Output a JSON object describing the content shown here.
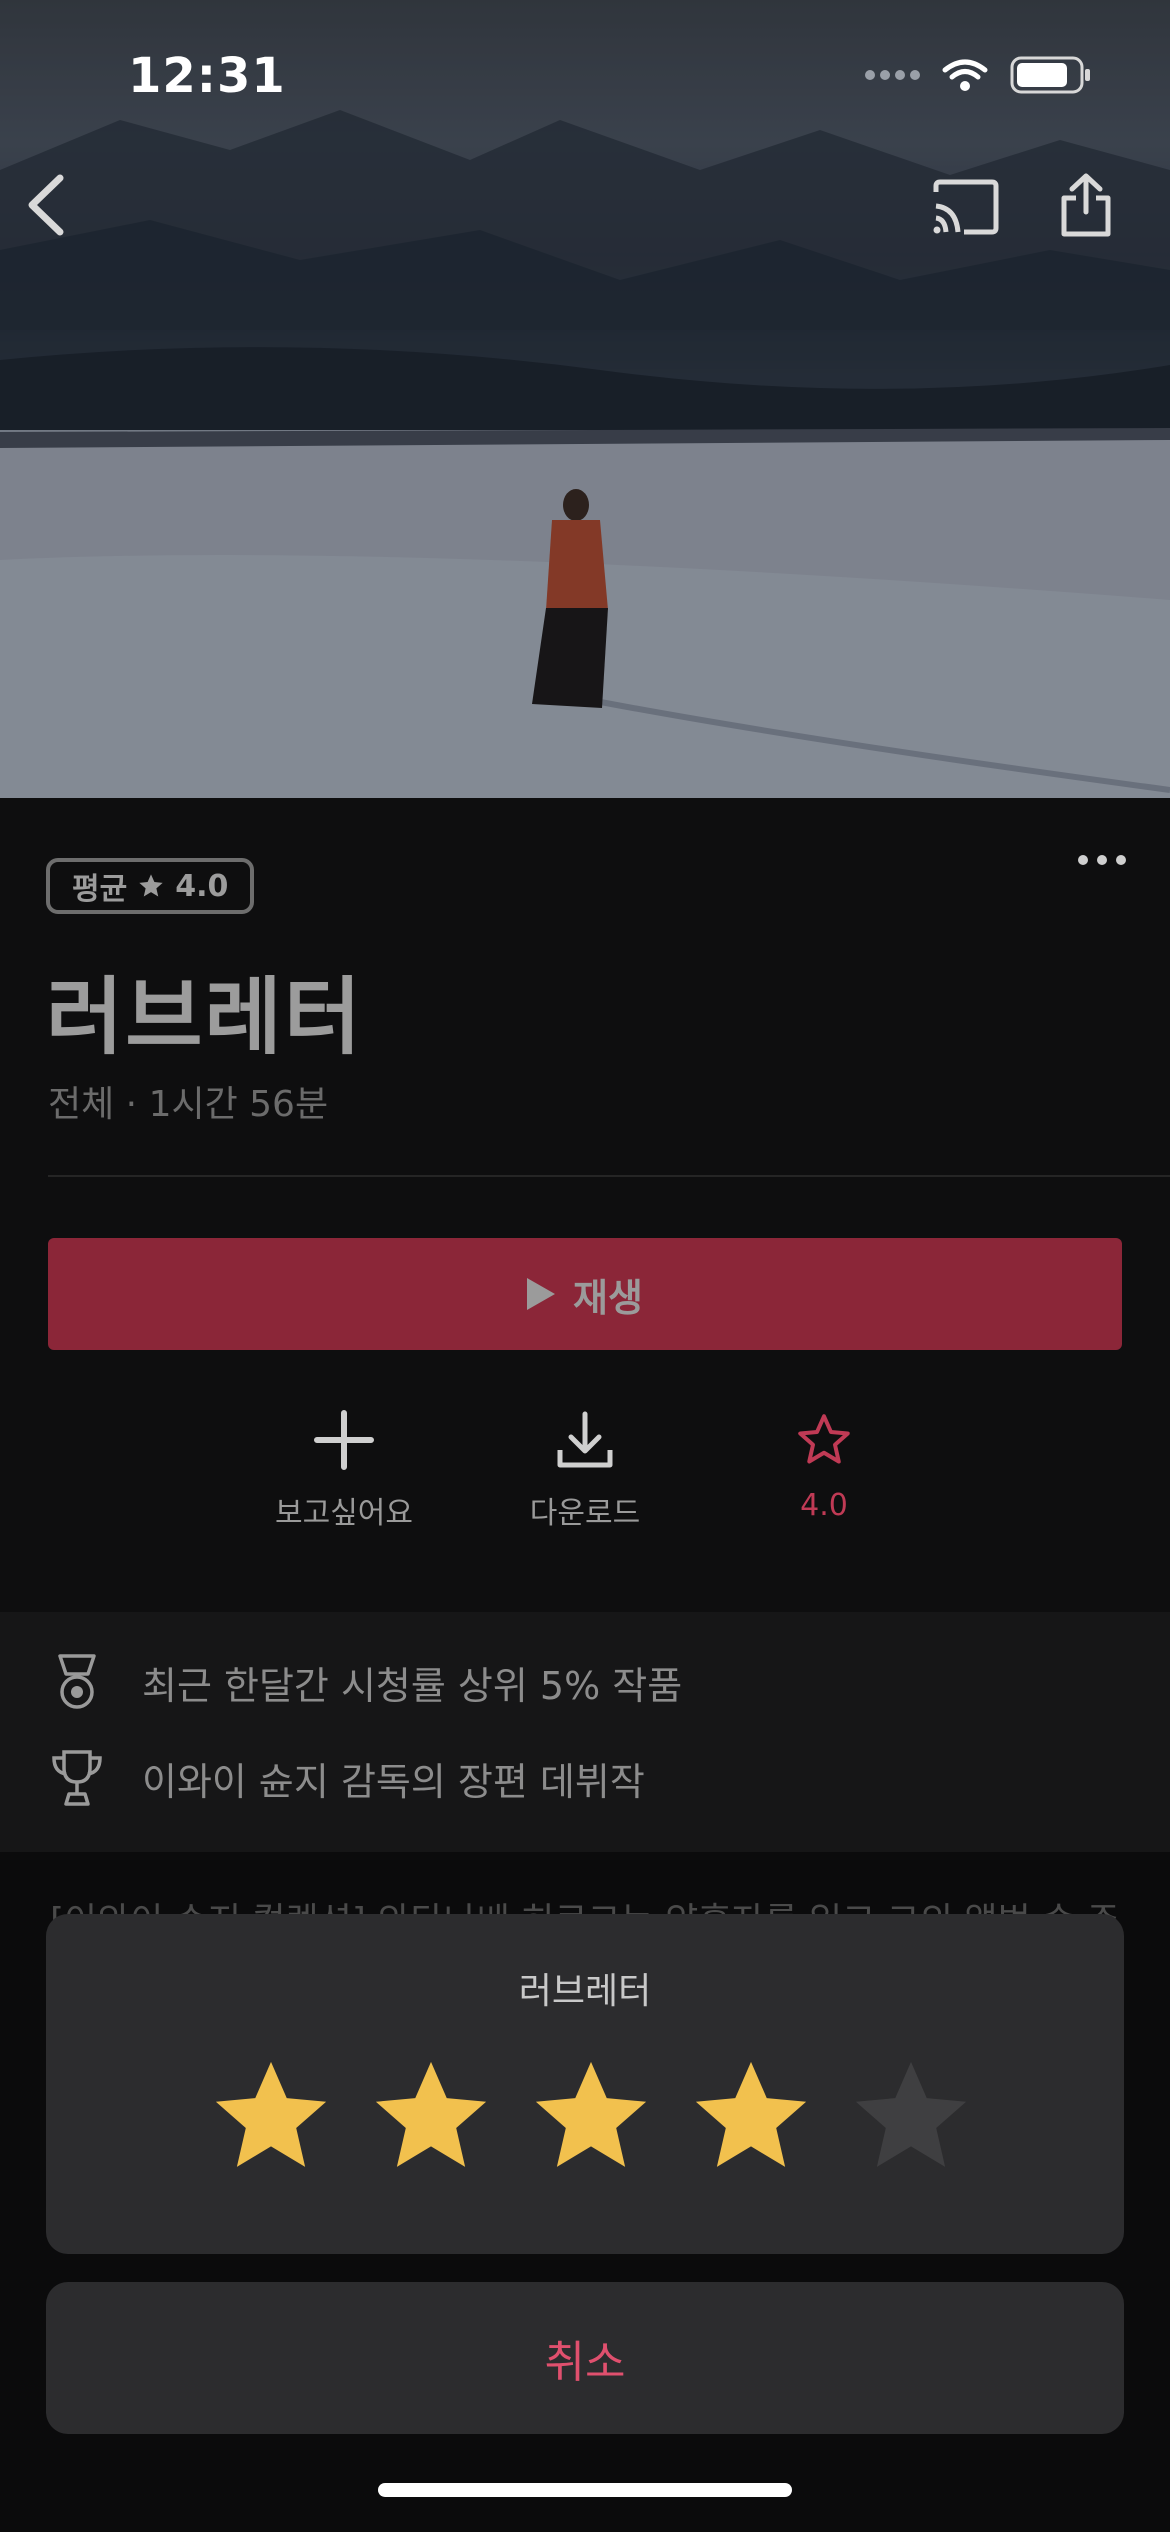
{
  "status_bar": {
    "time": "12:31"
  },
  "nav": {
    "back_icon": "chevron-left-icon",
    "cast_icon": "cast-icon",
    "share_icon": "share-icon"
  },
  "movie": {
    "rating_badge": {
      "prefix": "평균",
      "value": "4.0"
    },
    "title": "러브레터",
    "meta": "전체 · 1시간 56분"
  },
  "play_button": {
    "label": "재생",
    "color": "#8b2638"
  },
  "actions": [
    {
      "label": "보고싶어요",
      "icon": "plus-icon"
    },
    {
      "label": "다운로드",
      "icon": "download-icon"
    },
    {
      "label": "4.0",
      "icon": "star-outline-icon",
      "color": "#c03a55"
    }
  ],
  "highlights": [
    {
      "icon": "medal-icon",
      "text": "최근 한달간 시청률 상위 5% 작품"
    },
    {
      "icon": "trophy-icon",
      "text": "이와이 슌지 감독의 장편 데뷔작"
    }
  ],
  "description_partial": "[이와이 슌지 컬렉션] 와타나베 히로코는 약혼자를 잃고 그의 앨범 속 주소로",
  "rating_sheet": {
    "title": "러브레터",
    "rating": 4,
    "max": 5,
    "filled_color": "#f2c14e",
    "empty_color": "#3f3f41",
    "cancel_label": "취소",
    "cancel_color": "#e0506e"
  }
}
